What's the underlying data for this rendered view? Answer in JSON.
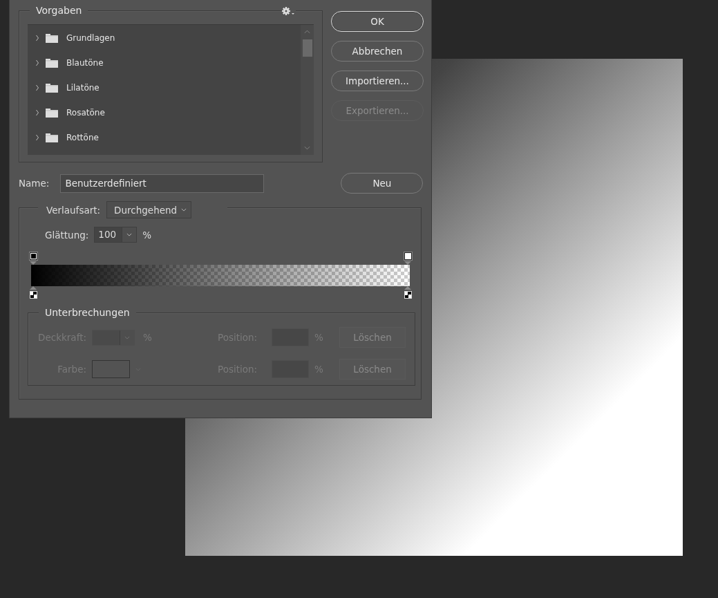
{
  "presets": {
    "title": "Vorgaben",
    "items": [
      {
        "label": "Grundlagen",
        "expanded": false
      },
      {
        "label": "Blautöne",
        "expanded": false
      },
      {
        "label": "Lilatöne",
        "expanded": false
      },
      {
        "label": "Rosatöne",
        "expanded": false
      },
      {
        "label": "Rottöne",
        "expanded": false
      }
    ]
  },
  "buttons": [
    {
      "label": "OK",
      "disabled": false,
      "default": true
    },
    {
      "label": "Abbrechen",
      "disabled": false,
      "default": false
    },
    {
      "label": "Importieren...",
      "disabled": false,
      "default": false
    },
    {
      "label": "Exportieren...",
      "disabled": true,
      "default": false
    }
  ],
  "name": {
    "label": "Name:",
    "value": "Benutzerdefiniert",
    "button": "Neu"
  },
  "gradient": {
    "type_label": "Verlaufsart:",
    "type_value": "Durchgehend",
    "smoothing_label": "Glättung:",
    "smoothing_value": "100",
    "smoothing_unit": "%",
    "stops": [
      {
        "color": "#000000"
      },
      {
        "color": "#ffffff"
      }
    ]
  },
  "stops_panel": {
    "title": "Unterbrechungen",
    "opacity": {
      "label": "Deckkraft:",
      "unit": "%",
      "disabled": true
    },
    "color": {
      "label": "Farbe:",
      "disabled": true
    },
    "positions": [
      {
        "label": "Position:",
        "unit": "%",
        "button": "Löschen",
        "disabled": true
      },
      {
        "label": "Position:",
        "unit": "%",
        "button": "Löschen",
        "disabled": true
      }
    ]
  }
}
